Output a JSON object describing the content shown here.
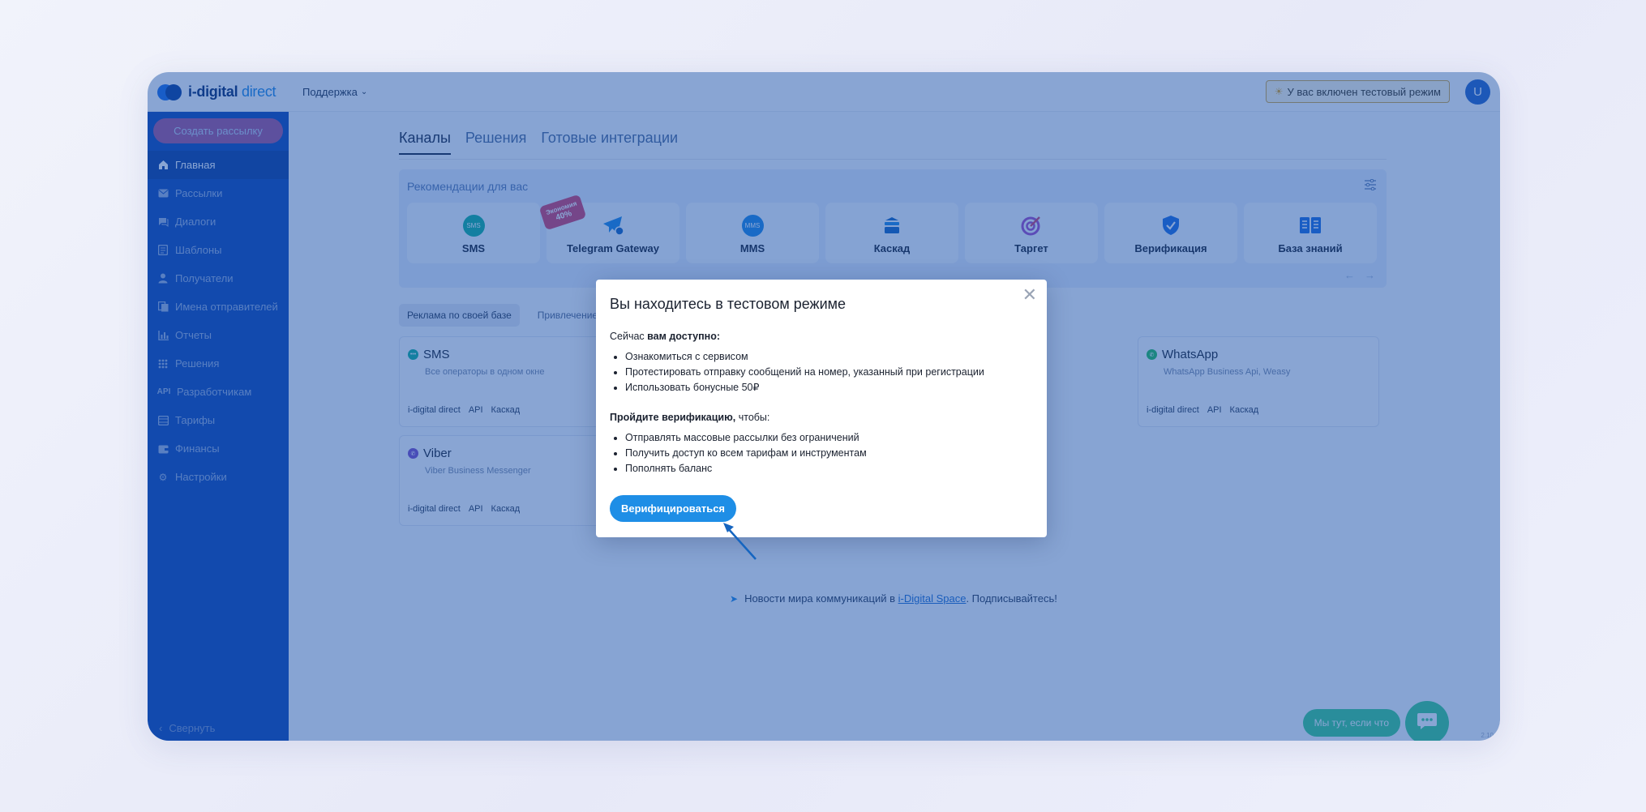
{
  "header": {
    "logo_main": "i-digital",
    "logo_accent": "direct",
    "support_label": "Поддержка",
    "test_mode_badge": "У вас включен тестовый режим",
    "avatar_letter": "U"
  },
  "sidebar": {
    "create_button": "Создать рассылку",
    "items": [
      {
        "label": "Главная",
        "icon": "home-icon"
      },
      {
        "label": "Рассылки",
        "icon": "mail-icon"
      },
      {
        "label": "Диалоги",
        "icon": "chat-icon"
      },
      {
        "label": "Шаблоны",
        "icon": "template-icon"
      },
      {
        "label": "Получатели",
        "icon": "person-icon"
      },
      {
        "label": "Имена отправителей",
        "icon": "sender-icon"
      },
      {
        "label": "Отчеты",
        "icon": "report-icon"
      },
      {
        "label": "Решения",
        "icon": "grid-icon"
      },
      {
        "label": "Разработчикам",
        "icon": "api-icon",
        "icon_text": "API"
      },
      {
        "label": "Тарифы",
        "icon": "tariff-icon"
      },
      {
        "label": "Финансы",
        "icon": "wallet-icon"
      },
      {
        "label": "Настройки",
        "icon": "gear-icon"
      }
    ],
    "collapse_label": "Свернуть"
  },
  "main": {
    "tabs": [
      "Каналы",
      "Решения",
      "Готовые интеграции"
    ],
    "recommendations": {
      "title": "Рекомендации для вас",
      "cards": [
        {
          "label": "SMS",
          "icon": "sms-icon",
          "icon_text": "SMS"
        },
        {
          "label": "Telegram Gateway",
          "icon": "telegram-icon",
          "badge_line1": "Экономия",
          "badge_line2": "40%"
        },
        {
          "label": "MMS",
          "icon": "mms-icon",
          "icon_text": "MMS"
        },
        {
          "label": "Каскад",
          "icon": "cascade-icon"
        },
        {
          "label": "Таргет",
          "icon": "target-icon"
        },
        {
          "label": "Верификация",
          "icon": "shield-check-icon"
        },
        {
          "label": "База знаний",
          "icon": "book-icon"
        }
      ]
    },
    "filters": [
      "Реклама по своей базе",
      "Привлечение"
    ],
    "channels": [
      {
        "name": "SMS",
        "sub": "Все операторы в одном окне",
        "tags": [
          "i-digital direct",
          "API",
          "Каскад"
        ]
      },
      {
        "name": "WhatsApp",
        "sub": "WhatsApp Business Api, Weasy",
        "tags": [
          "i-digital direct",
          "API",
          "Каскад"
        ]
      },
      {
        "name": "Viber",
        "sub": "Viber Business Messenger",
        "tags": [
          "i-digital direct",
          "API",
          "Каскад"
        ]
      }
    ],
    "news": {
      "prefix": "Новости мира коммуникаций в ",
      "link": "i-Digital Space",
      "suffix": ". Подписывайтесь!"
    },
    "help_label": "Мы тут, если что",
    "version": "2.10"
  },
  "modal": {
    "title": "Вы находитесь в тестовом режиме",
    "available_prefix": "Сейчас ",
    "available_bold": "вам доступно:",
    "available_items": [
      "Ознакомиться с сервисом",
      "Протестировать отправку сообщений на номер, указанный при регистрации",
      "Использовать бонусные 50₽"
    ],
    "verify_bold": "Пройдите верификацию,",
    "verify_suffix": " чтобы:",
    "verify_items": [
      "Отправлять массовые рассылки без ограничений",
      "Получить доступ ко всем тарифам и инструментам",
      "Пополнять баланс"
    ],
    "verify_button": "Верифицироваться"
  },
  "colors": {
    "sidebar": "#1148b4",
    "overlay": "#134ca8",
    "primary": "#1e8ee6",
    "create_button": "#d85a8a",
    "help": "#3fcf8e"
  }
}
